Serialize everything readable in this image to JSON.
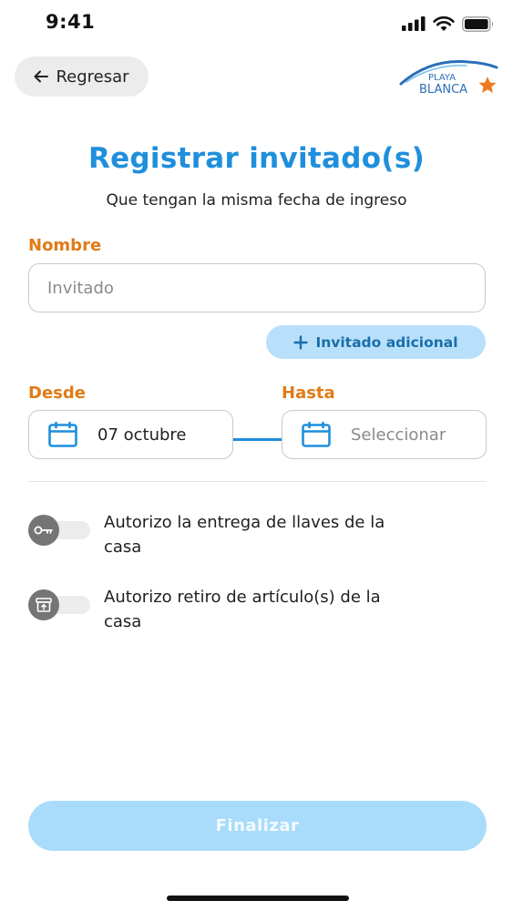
{
  "status_bar": {
    "time": "9:41"
  },
  "header": {
    "back_label": "Regresar",
    "logo": {
      "line1": "PLAYA",
      "line2": "BLANCA"
    }
  },
  "title": "Registrar invitado(s)",
  "subtitle": "Que tengan la misma fecha de ingreso",
  "name_field": {
    "label": "Nombre",
    "placeholder": "Invitado",
    "value": ""
  },
  "add_guest_label": "Invitado adicional",
  "date_from": {
    "label": "Desde",
    "value": "07 octubre"
  },
  "date_to": {
    "label": "Hasta",
    "placeholder": "Seleccionar"
  },
  "permissions": [
    {
      "line1": "Autorizo la entrega de llaves de la",
      "line2": "casa",
      "icon": "key-icon",
      "enabled": false
    },
    {
      "line1": "Autorizo retiro de artículo(s) de la",
      "line2": "casa",
      "icon": "box-icon",
      "enabled": false
    }
  ],
  "finish_label": "Finalizar",
  "colors": {
    "accent": "#1f8fdc",
    "label_orange": "#e07b16",
    "button_disabled": "#a9dcfb"
  }
}
